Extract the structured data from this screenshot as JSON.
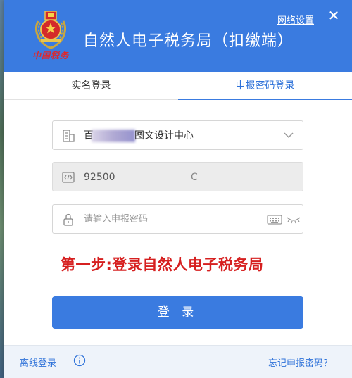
{
  "header": {
    "emblem_caption": "中国税务",
    "title": "自然人电子税务局（扣缴端）",
    "network_settings": "网络设置",
    "close_glyph": "✕"
  },
  "tabs": [
    {
      "label": "实名登录",
      "active": false
    },
    {
      "label": "申报密码登录",
      "active": true
    }
  ],
  "form": {
    "company": {
      "prefix": "百",
      "suffix": "图文设计中心"
    },
    "tax_id": {
      "prefix": "92500",
      "tail": "C"
    },
    "password": {
      "placeholder": "请输入申报密码",
      "value": ""
    }
  },
  "step_text": "第一步:登录自然人电子税务局",
  "login_button": "登 录",
  "footer": {
    "offline_login": "离线登录",
    "forgot_password": "忘记申报密码？"
  },
  "colors": {
    "primary": "#3a7be0",
    "step_red": "#d62020",
    "link_blue": "#2e72d9"
  }
}
